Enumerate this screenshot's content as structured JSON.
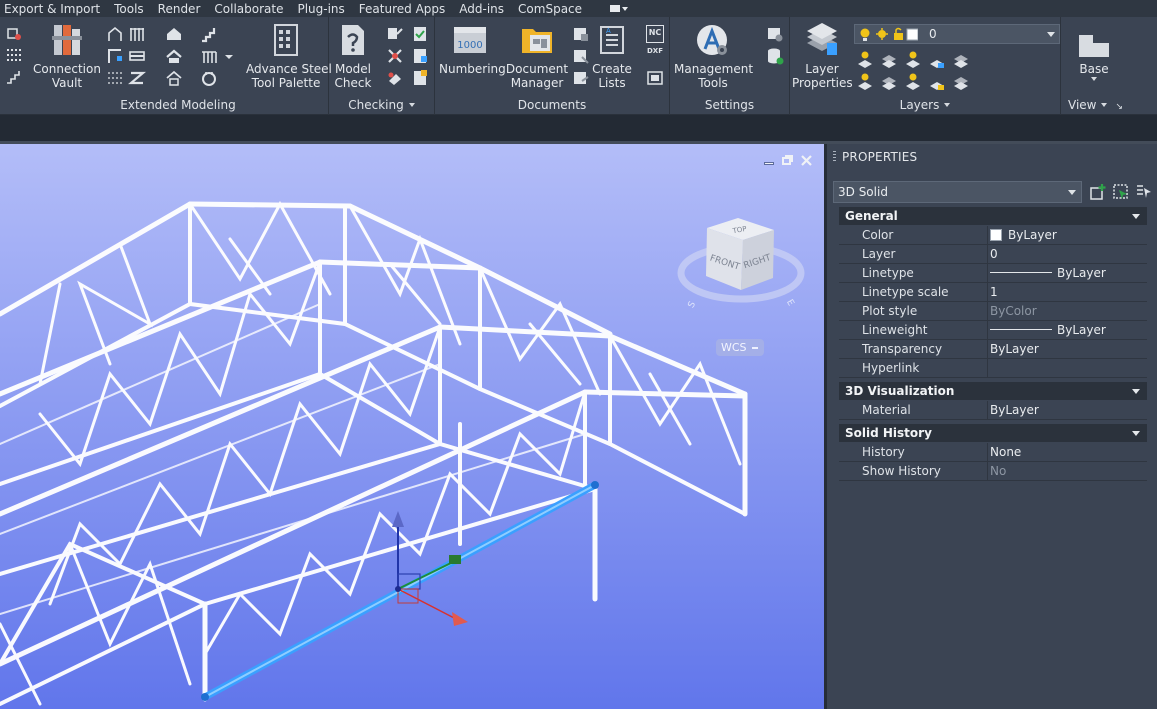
{
  "menu": {
    "tabs": [
      "Export & Import",
      "Tools",
      "Render",
      "Collaborate",
      "Plug-ins",
      "Featured Apps",
      "Add-ins",
      "ComSpace"
    ]
  },
  "ribbon": {
    "panels": {
      "extended_modeling": {
        "title": "Extended Modeling",
        "connection_vault_line1": "Connection",
        "connection_vault_line2": "Vault",
        "tool_palette_line1": "Advance Steel",
        "tool_palette_line2": "Tool Palette"
      },
      "checking": {
        "title": "Checking",
        "model_check_line1": "Model",
        "model_check_line2": "Check"
      },
      "documents": {
        "title": "Documents",
        "numbering": "Numbering",
        "numbering_icon_text": "1000",
        "document_manager_line1": "Document",
        "document_manager_line2": "Manager",
        "create_lists_line1": "Create",
        "create_lists_line2": "Lists",
        "nc_label": "NC",
        "dxf_label": "DXF"
      },
      "settings": {
        "title": "Settings",
        "management_tools_line1": "Management",
        "management_tools_line2": "Tools"
      },
      "layers": {
        "title": "Layers",
        "layer_properties_line1": "Layer",
        "layer_properties_line2": "Properties",
        "current_layer": "0"
      },
      "view": {
        "title": "View",
        "base": "Base"
      }
    }
  },
  "viewport": {
    "viewcube": {
      "top": "TOP",
      "front": "FRONT",
      "right": "RIGHT",
      "compass_s": "S",
      "compass_e": "E"
    },
    "wcs_label": "WCS"
  },
  "properties": {
    "title": "PROPERTIES",
    "object_type": "3D Solid",
    "sections": {
      "general": {
        "title": "General",
        "rows": [
          {
            "key": "Color",
            "value": "ByLayer"
          },
          {
            "key": "Layer",
            "value": "0"
          },
          {
            "key": "Linetype",
            "value": "ByLayer"
          },
          {
            "key": "Linetype scale",
            "value": "1"
          },
          {
            "key": "Plot style",
            "value": "ByColor"
          },
          {
            "key": "Lineweight",
            "value": "ByLayer"
          },
          {
            "key": "Transparency",
            "value": "ByLayer"
          },
          {
            "key": "Hyperlink",
            "value": ""
          }
        ]
      },
      "visualization": {
        "title": "3D Visualization",
        "rows": [
          {
            "key": "Material",
            "value": "ByLayer"
          }
        ]
      },
      "solid_history": {
        "title": "Solid History",
        "rows": [
          {
            "key": "History",
            "value": "None"
          },
          {
            "key": "Show History",
            "value": "No"
          }
        ]
      }
    }
  },
  "colors": {
    "ribbon_bg": "#3b4453",
    "viewport_top": "#b3bdf8",
    "viewport_bottom": "#6176eb",
    "selected_beam": "#3aa0ff"
  }
}
